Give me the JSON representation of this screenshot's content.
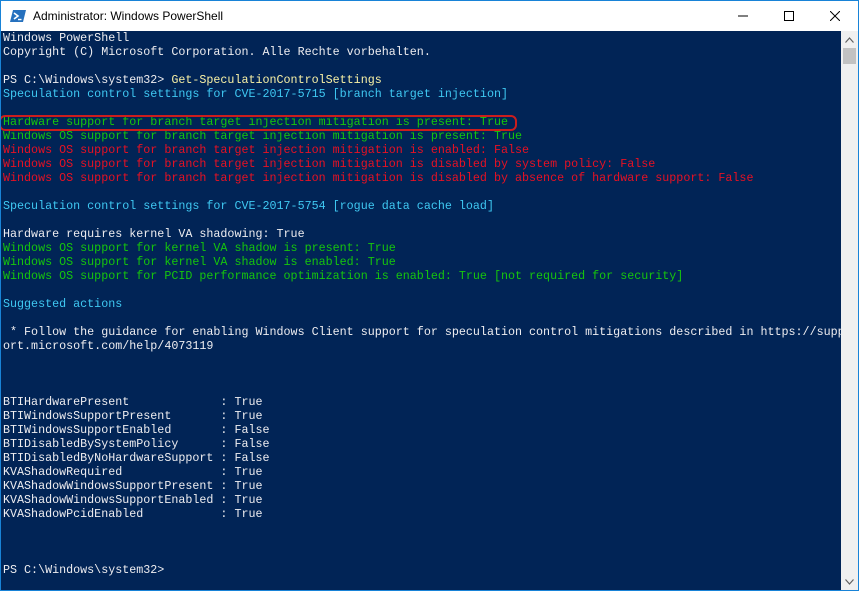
{
  "window": {
    "title": "Administrator: Windows PowerShell"
  },
  "controls": {
    "minimize_icon": "minimize-icon",
    "maximize_icon": "maximize-icon",
    "close_icon": "close-icon"
  },
  "colors": {
    "console_bg": "#012456",
    "white": "#eeedf0",
    "cyan": "#3fc8f2",
    "green": "#16c60c",
    "red": "#e81123",
    "yellow": "#f9f1a5",
    "highlight": "#cc1d1d"
  },
  "console": {
    "header1": "Windows PowerShell",
    "header2": "Copyright (C) Microsoft Corporation. Alle Rechte vorbehalten.",
    "prompt1": "PS C:\\Windows\\system32> ",
    "command1": "Get-SpeculationControlSettings",
    "cve1_header": "Speculation control settings for CVE-2017-5715 [branch target injection]",
    "cve1_lines": [
      "Hardware support for branch target injection mitigation is present: True",
      "Windows OS support for branch target injection mitigation is present: True",
      "Windows OS support for branch target injection mitigation is enabled: False",
      "Windows OS support for branch target injection mitigation is disabled by system policy: False",
      "Windows OS support for branch target injection mitigation is disabled by absence of hardware support: False"
    ],
    "cve2_header": "Speculation control settings for CVE-2017-5754 [rogue data cache load]",
    "cve2_line_white": "Hardware requires kernel VA shadowing: True",
    "cve2_lines_green": [
      "Windows OS support for kernel VA shadow is present: True",
      "Windows OS support for kernel VA shadow is enabled: True",
      "Windows OS support for PCID performance optimization is enabled: True [not required for security]"
    ],
    "suggested_header": "Suggested actions",
    "suggested_line1": " * Follow the guidance for enabling Windows Client support for speculation control mitigations described in https://supp",
    "suggested_line2": "ort.microsoft.com/help/4073119",
    "table": [
      "BTIHardwarePresent             : True",
      "BTIWindowsSupportPresent       : True",
      "BTIWindowsSupportEnabled       : False",
      "BTIDisabledBySystemPolicy      : False",
      "BTIDisabledByNoHardwareSupport : False",
      "KVAShadowRequired              : True",
      "KVAShadowWindowsSupportPresent : True",
      "KVAShadowWindowsSupportEnabled : True",
      "KVAShadowPcidEnabled           : True"
    ],
    "prompt2": "PS C:\\Windows\\system32>"
  }
}
